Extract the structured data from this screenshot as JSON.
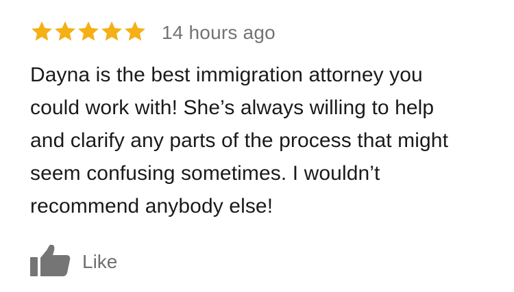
{
  "review": {
    "rating": 5,
    "rating_max": 5,
    "star_color": "#F5B015",
    "timestamp": "14 hours ago",
    "text_lines": [
      "Dayna is the best immigration attorney you",
      "could work with! She’s always willing to help",
      "and clarify any parts of the process that might",
      "seem confusing sometimes. I wouldn’t",
      "recommend anybody else!"
    ]
  },
  "actions": {
    "like_label": "Like",
    "like_icon": "thumbs-up-icon",
    "icon_color": "#757575"
  }
}
